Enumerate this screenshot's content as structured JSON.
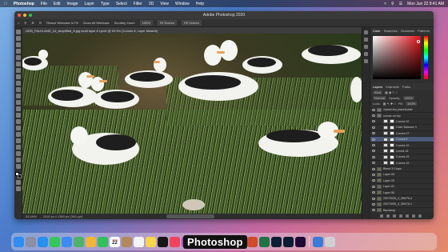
{
  "menubar": {
    "app_name": "Photoshop",
    "items": [
      "File",
      "Edit",
      "Image",
      "Layer",
      "Type",
      "Select",
      "Filter",
      "3D",
      "View",
      "Window",
      "Help"
    ],
    "clock": "Mon Jun 22 9:41 AM"
  },
  "window": {
    "title": "Adobe Photoshop 2020",
    "options": [
      "Resize Windows to Fit",
      "Zoom All Windows",
      "Scrubby Zoom",
      "100%",
      "Fit Screen",
      "Fill Screen"
    ],
    "doc_tab": "GDR_FALKLAND_14_simplified_5.jpg multi layer 8 Lpxel @ 53.3% (Curves 8, Layer Mask/8)",
    "status_zoom": "53.49%",
    "status_info": "2415 px x 1360 px (300 ppi)"
  },
  "panels": {
    "top_tabs": [
      "Color",
      "Swatches",
      "Gradients",
      "Patterns"
    ],
    "layer_tabs": [
      "Layers",
      "Channels",
      "Paths"
    ],
    "kind_label": "Kind",
    "blend_mode": "Normal",
    "opacity_label": "Opacity:",
    "opacity_value": "100%",
    "lock_label": "Lock:",
    "fill_label": "Fill:",
    "fill_value": "100%",
    "layers": [
      {
        "name": "vadual key placeholder",
        "kind": "group"
      },
      {
        "name": "curves on top",
        "kind": "group"
      },
      {
        "name": "Curves 10",
        "kind": "adj"
      },
      {
        "name": "Color Balance 3",
        "kind": "adj"
      },
      {
        "name": "Curves 07",
        "kind": "adj"
      },
      {
        "name": "Curves 8",
        "kind": "adj",
        "selected": true
      },
      {
        "name": "Curves 10",
        "kind": "adj"
      },
      {
        "name": "Levels 18",
        "kind": "adj"
      },
      {
        "name": "Curves 19",
        "kind": "adj"
      },
      {
        "name": "Curves 19",
        "kind": "adj"
      },
      {
        "name": "Blend 3 Crops",
        "kind": "pixel"
      },
      {
        "name": "Layer 26",
        "kind": "pixel"
      },
      {
        "name": "Layer 25",
        "kind": "pixel"
      },
      {
        "name": "Layer 51",
        "kind": "pixel"
      },
      {
        "name": "Layer 50",
        "kind": "pixel"
      },
      {
        "name": "20070005_4_050/76-4",
        "kind": "pixel"
      },
      {
        "name": "20070005_4_050/76-1",
        "kind": "pixel"
      },
      {
        "name": "Backdrop",
        "kind": "pixel"
      }
    ]
  },
  "dock": {
    "tooltip": "Photoshop",
    "calendar_month": "JUN",
    "calendar_day": "22",
    "apps": [
      {
        "name": "finder",
        "color": "#2f8cf0"
      },
      {
        "name": "launchpad",
        "color": "#8b8fa6"
      },
      {
        "name": "safari",
        "color": "#2b8ff0"
      },
      {
        "name": "messages",
        "color": "#36c75a"
      },
      {
        "name": "mail",
        "color": "#3b8df1"
      },
      {
        "name": "maps",
        "color": "#4fb26a"
      },
      {
        "name": "photos",
        "color": "#f2b53a"
      },
      {
        "name": "facetime",
        "color": "#33c05a"
      },
      {
        "name": "calendar",
        "color": "#ffffff"
      },
      {
        "name": "contacts",
        "color": "#b08a5e"
      },
      {
        "name": "reminders",
        "color": "#f4f4f4"
      },
      {
        "name": "notes",
        "color": "#f7d54a"
      },
      {
        "name": "appletv",
        "color": "#161616"
      },
      {
        "name": "music",
        "color": "#f2435b"
      },
      {
        "name": "podcasts",
        "color": "#9a4bd6"
      },
      {
        "name": "news",
        "color": "#ee3f4d"
      },
      {
        "name": "appstore",
        "color": "#2a8cf2"
      },
      {
        "name": "settings",
        "color": "#8b8b8f"
      },
      {
        "name": "word",
        "color": "#2b5cc4"
      },
      {
        "name": "powerpoint",
        "color": "#d04a2a"
      },
      {
        "name": "excel",
        "color": "#217346"
      },
      {
        "name": "lightroom",
        "color": "#0c2035"
      },
      {
        "name": "photoshop",
        "color": "#0a1d33"
      },
      {
        "name": "premiere",
        "color": "#1d0b34"
      },
      {
        "name": "downloads",
        "color": "#3a7bd8"
      },
      {
        "name": "trash",
        "color": "#cfcfd4"
      }
    ]
  }
}
